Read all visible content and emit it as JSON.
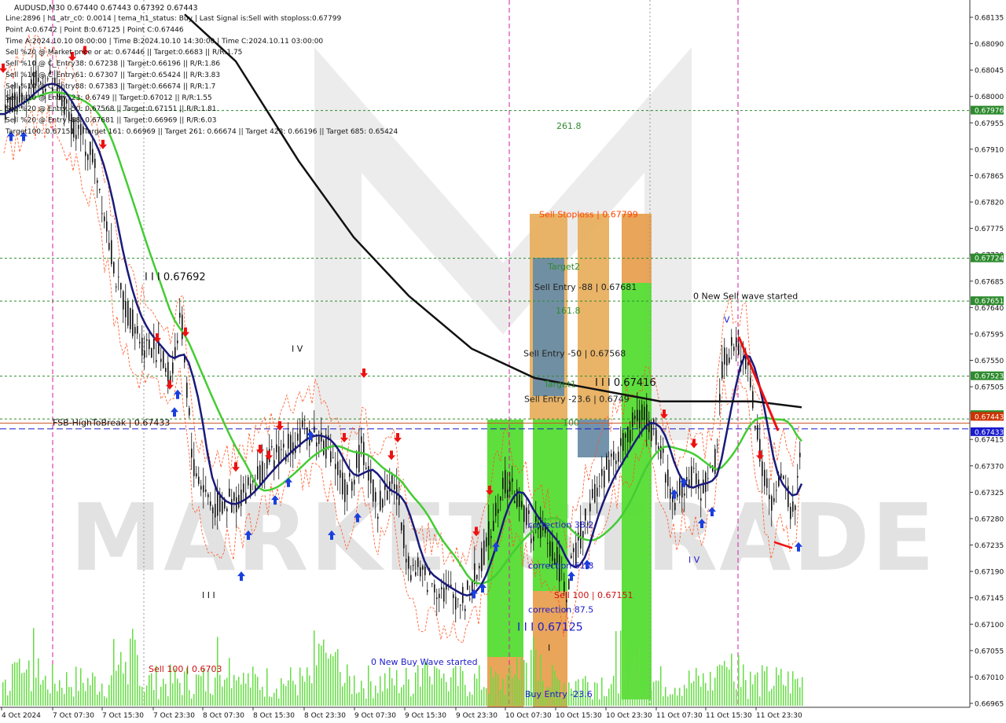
{
  "chart_data": {
    "type": "candlestick",
    "symbol_line": "AUDUSD,M30  0.67440 0.67443 0.67392 0.67443",
    "info_lines": [
      "Line:2896 | h1_atr_c0: 0.0014 | tema_h1_status: Buy | Last Signal is:Sell with stoploss:0.67799",
      "Point A:0.6742 | Point B:0.67125 | Point C:0.67446",
      "Time A:2024.10.10 08:00:00 | Time B:2024.10.10 14:30:00 | Time C:2024.10.11 03:00:00",
      "Sell %20 @ Market price or at: 0.67446 || Target:0.6683 || R/R:1.75",
      "Sell %10 @ C_Entry38: 0.67238 || Target:0.66196 || R/R:1.86",
      "Sell %10 @ C_Entry61: 0.67307 || Target:0.65424 || R/R:3.83",
      "Sell %10 @ C_Entry88: 0.67383 || Target:0.66674 || R/R:1.7",
      "Sell %10 @ Entry -23: 0.6749 || Target:0.67012 || R/R:1.55",
      "Sell %20 @ Entry -50: 0.67568 || Target:0.67151 || R/R:1.81",
      "Sell %20 @ Entry -88: 0.67681 || Target:0.66969 || R/R:6.03",
      "Target100: 0.67151 || Target 161: 0.66969 || Target 261: 0.66674 || Target 423: 0.66196 || Target 685: 0.65424"
    ],
    "y_ticks": [
      "0.68135",
      "0.68090",
      "0.68045",
      "0.68000",
      "0.67955",
      "0.67910",
      "0.67865",
      "0.67820",
      "0.67775",
      "0.67730",
      "0.67685",
      "0.67640",
      "0.67595",
      "0.67550",
      "0.67505",
      "0.67460",
      "0.67415",
      "0.67370",
      "0.67325",
      "0.67280",
      "0.67235",
      "0.67190",
      "0.67145",
      "0.67100",
      "0.67055",
      "0.67010",
      "0.66965"
    ],
    "y_min": 0.66955,
    "y_max": 0.68155,
    "x_labels": [
      "4 Oct 2024",
      "7 Oct 07:30",
      "7 Oct 15:30",
      "7 Oct 23:30",
      "8 Oct 07:30",
      "8 Oct 15:30",
      "8 Oct 23:30",
      "9 Oct 07:30",
      "9 Oct 15:30",
      "9 Oct 23:30",
      "10 Oct 07:30",
      "10 Oct 15:30",
      "10 Oct 23:30",
      "11 Oct 07:30",
      "11 Oct 15:30",
      "11 Oct 23:30"
    ],
    "price_labels": [
      {
        "text": "0.67976",
        "value": 0.67976,
        "bg": "#2e8b2e"
      },
      {
        "text": "0.67724",
        "value": 0.67724,
        "bg": "#2e8b2e"
      },
      {
        "text": "0.67651",
        "value": 0.67651,
        "bg": "#2e8b2e"
      },
      {
        "text": "0.67523",
        "value": 0.67523,
        "bg": "#2e8b2e"
      },
      {
        "text": "0.67450",
        "value": 0.6745,
        "bg": "#2e8b2e"
      },
      {
        "text": "0.67443",
        "value": 0.67443,
        "bg": "#cc3300"
      },
      {
        "text": "0.67433",
        "value": 0.67433,
        "bg": "#1a1acc"
      }
    ],
    "annotations": [
      {
        "text": "261.8",
        "value": 0.6795,
        "color": "#2e8b2e"
      },
      {
        "text": "Sell Stoploss | 0.67799",
        "value": 0.67799,
        "color": "#ff4500"
      },
      {
        "text": "Target2",
        "value": 0.6771,
        "color": "#2e8b2e"
      },
      {
        "text": "Sell Entry -88 | 0.67681",
        "value": 0.67675,
        "color": "#222222"
      },
      {
        "text": "161.8",
        "value": 0.67635,
        "color": "#2e8b2e"
      },
      {
        "text": "Sell Entry -50 | 0.67568",
        "value": 0.67562,
        "color": "#222222"
      },
      {
        "text": "Target1",
        "value": 0.6751,
        "color": "#2e8b2e"
      },
      {
        "text": "Sell Entry -23.6 | 0.6749",
        "value": 0.67484,
        "color": "#222222"
      },
      {
        "text": "100",
        "value": 0.67444,
        "color": "#2e8b2e"
      },
      {
        "text": "I I I  0.67692",
        "value": 0.67692,
        "color": "#111111"
      },
      {
        "text": "I V",
        "value": 0.6757,
        "color": "#111111"
      },
      {
        "text": "I I I  0.67416",
        "value": 0.67512,
        "color": "#111111"
      },
      {
        "text": "0 New Sell wave started",
        "value": 0.6766,
        "color": "#111111"
      },
      {
        "text": "V",
        "value": 0.6762,
        "color": "#1a1acc"
      },
      {
        "text": "I V",
        "value": 0.6721,
        "color": "#1a1acc"
      },
      {
        "text": "FSB-HighToBreak | 0.67433",
        "value": 0.67444,
        "color": "#111111"
      },
      {
        "text": "correction 38.2",
        "value": 0.6727,
        "color": "#1a1acc"
      },
      {
        "text": "correction 61.8",
        "value": 0.672,
        "color": "#1a1acc"
      },
      {
        "text": "correction 87.5",
        "value": 0.67125,
        "color": "#1a1acc"
      },
      {
        "text": "Sell 100 | 0.67151",
        "value": 0.6715,
        "color": "#cc1111"
      },
      {
        "text": "I I I  0.67125",
        "value": 0.67094,
        "color": "#1a1acc"
      },
      {
        "text": "I",
        "value": 0.6706,
        "color": "#111111"
      },
      {
        "text": "0 New Buy Wave started",
        "value": 0.67036,
        "color": "#1a1acc"
      },
      {
        "text": "Sell 100 | 0.6703",
        "value": 0.67024,
        "color": "#cc1111"
      },
      {
        "text": "Buy Entry -23.6",
        "value": 0.66981,
        "color": "#1a1acc"
      },
      {
        "text": "I I I",
        "value": 0.6715,
        "color": "#111111"
      }
    ],
    "watermark": "MARKETSTRADE"
  }
}
